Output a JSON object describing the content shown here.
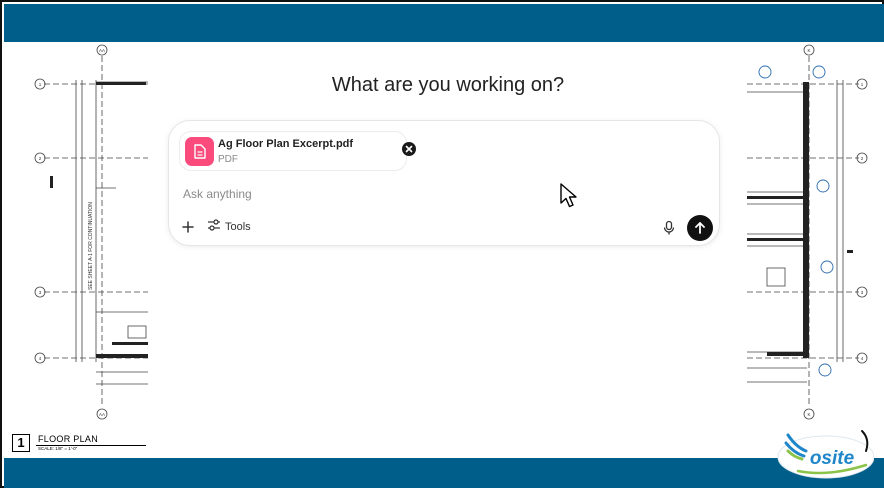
{
  "main": {
    "heading": "What are you working on?"
  },
  "composer": {
    "attachment": {
      "file_name": "Ag Floor Plan Excerpt.pdf",
      "file_type": "PDF",
      "icon": "document-icon",
      "remove_icon": "close-icon"
    },
    "input_placeholder": "Ask anything",
    "tools_label": "Tools",
    "icons": {
      "add": "plus-icon",
      "tools": "sliders-icon",
      "mic": "microphone-icon",
      "send": "arrow-up-icon"
    }
  },
  "sheet": {
    "number": "1",
    "title": "FLOOR PLAN",
    "scale": "SCALE: 1/8\" = 1'-0\"",
    "side_note": "SEE SHEET A-1 FOR CONTINUATION",
    "grid_left": [
      "1",
      "2",
      "3",
      "4"
    ],
    "grid_right": [
      "1",
      "2",
      "3",
      "4"
    ],
    "grid_col_left": "AA",
    "grid_col_right": "K"
  },
  "logo": {
    "text": "osite"
  },
  "colors": {
    "banner": "#005e8a",
    "file_icon": "#fa4b7c",
    "send_button": "#111111",
    "logo_blue": "#1f87c9",
    "logo_green": "#8bc34a"
  }
}
